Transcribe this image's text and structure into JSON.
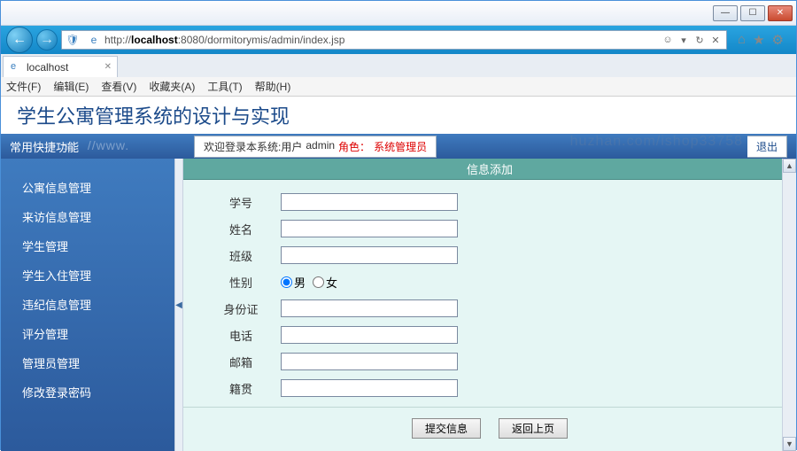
{
  "window": {
    "min": "—",
    "max": "☐",
    "close": "✕"
  },
  "nav": {
    "url_prefix": "http://",
    "url_host": "localhost",
    "url_port": ":8080",
    "url_path": "/dormitorymis/admin/index.jsp"
  },
  "tab": {
    "title": "localhost"
  },
  "menus": [
    "文件(F)",
    "编辑(E)",
    "查看(V)",
    "收藏夹(A)",
    "工具(T)",
    "帮助(H)"
  ],
  "app": {
    "title": "学生公寓管理系统的设计与实现",
    "sidebar_header": "常用快捷功能",
    "watermark_bar": "s ：//www.",
    "welcome_prefix": "欢迎登录本系统:用户",
    "user": "admin",
    "role_label": "角色：",
    "role_value": "系统管理员",
    "logout": "退出"
  },
  "sidebar": {
    "items": [
      "公寓信息管理",
      "来访信息管理",
      "学生管理",
      "学生入住管理",
      "违纪信息管理",
      "评分管理",
      "管理员管理",
      "修改登录密码"
    ]
  },
  "form": {
    "header": "信息添加",
    "fields": {
      "sno": "学号",
      "name": "姓名",
      "class": "班级",
      "gender": "性别",
      "gender_m": "男",
      "gender_f": "女",
      "idcard": "身份证",
      "phone": "电话",
      "email": "邮箱",
      "native": "籍贯"
    },
    "submit": "提交信息",
    "back": "返回上页"
  },
  "watermark": "huzhan.com/ishop33758"
}
